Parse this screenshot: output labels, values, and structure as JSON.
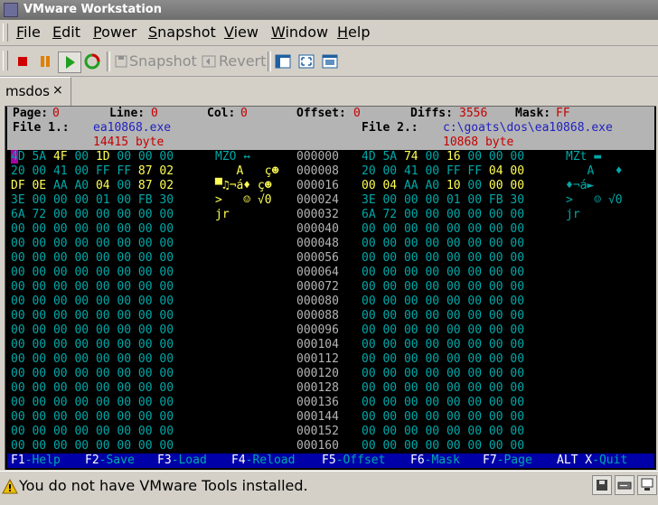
{
  "window": {
    "title": "VMware Workstation"
  },
  "menu": [
    "File",
    "Edit",
    "Power",
    "Snapshot",
    "View",
    "Window",
    "Help"
  ],
  "menu_mnemonics": [
    "F",
    "E",
    "P",
    "S",
    "V",
    "W",
    "H"
  ],
  "toolbar": {
    "snapshot_label": "Snapshot",
    "revert_label": "Revert"
  },
  "tab": {
    "label": "msdos",
    "close": "×"
  },
  "header": {
    "page_label": "Page:",
    "page_value": "0",
    "line_label": "Line:",
    "line_value": "0",
    "col_label": "Col:",
    "col_value": "0",
    "offset_label": "Offset:",
    "offset_value": "0",
    "diffs_label": "Diffs:",
    "diffs_value": "3556",
    "mask_label": "Mask:",
    "mask_value": "FF",
    "file1_label": "File 1.:",
    "file1_name": "ea10868.exe",
    "file1_size": "14415 byte",
    "file2_label": "File 2.:",
    "file2_name": "c:\\goats\\dos\\ea10868.exe",
    "file2_size": "10868 byte"
  },
  "offsets": [
    "000000",
    "000008",
    "000016",
    "000024",
    "000032",
    "000040",
    "000048",
    "000056",
    "000064",
    "000072",
    "000080",
    "000088",
    "000096",
    "000104",
    "000112",
    "000120",
    "000128",
    "000136",
    "000144",
    "000152",
    "000160"
  ],
  "left_rows": [
    "4D 5A 4F 00 1D 00 00 00",
    "20 00 41 00 FF FF 87 02",
    "DF 0E AA A0 04 00 87 02",
    "3E 00 00 00 01 00 FB 30",
    "6A 72 00 00 00 00 00 00",
    "00 00 00 00 00 00 00 00",
    "00 00 00 00 00 00 00 00",
    "00 00 00 00 00 00 00 00",
    "00 00 00 00 00 00 00 00",
    "00 00 00 00 00 00 00 00",
    "00 00 00 00 00 00 00 00",
    "00 00 00 00 00 00 00 00",
    "00 00 00 00 00 00 00 00",
    "00 00 00 00 00 00 00 00",
    "00 00 00 00 00 00 00 00",
    "00 00 00 00 00 00 00 00",
    "00 00 00 00 00 00 00 00",
    "00 00 00 00 00 00 00 00",
    "00 00 00 00 00 00 00 00",
    "00 00 00 00 00 00 00 00",
    "00 00 00 00 00 00 00 00"
  ],
  "right_rows": [
    "4D 5A 74 00 16 00 00 00",
    "20 00 41 00 FF FF 04 00",
    "00 04 AA A0 10 00 00 00",
    "3E 00 00 00 01 00 FB 30",
    "6A 72 00 00 00 00 00 00",
    "00 00 00 00 00 00 00 00",
    "00 00 00 00 00 00 00 00",
    "00 00 00 00 00 00 00 00",
    "00 00 00 00 00 00 00 00",
    "00 00 00 00 00 00 00 00",
    "00 00 00 00 00 00 00 00",
    "00 00 00 00 00 00 00 00",
    "00 00 00 00 00 00 00 00",
    "00 00 00 00 00 00 00 00",
    "00 00 00 00 00 00 00 00",
    "00 00 00 00 00 00 00 00",
    "00 00 00 00 00 00 00 00",
    "00 00 00 00 00 00 00 00",
    "00 00 00 00 00 00 00 00",
    "00 00 00 00 00 00 00 00",
    "00 00 00 00 00 00 00 00"
  ],
  "left_ascii": [
    "MZO ↔",
    "   A   ç☻",
    "▀♫¬á♦ ç☻",
    ">   ☺ √0",
    "jr"
  ],
  "right_ascii": [
    "MZt ▬",
    "   A   ♦",
    "♦¬á►",
    ">   ☺ √0",
    "jr"
  ],
  "fkeys": [
    {
      "key": "F1",
      "label": "-Help"
    },
    {
      "key": "F2",
      "label": "-Save"
    },
    {
      "key": "F3",
      "label": "-Load"
    },
    {
      "key": "F4",
      "label": "-Reload"
    },
    {
      "key": "F5",
      "label": "-Offset"
    },
    {
      "key": "F6",
      "label": "-Mask"
    },
    {
      "key": "F7",
      "label": "-Page"
    },
    {
      "key": "ALT X",
      "label": "-Quit"
    }
  ],
  "status": {
    "message": "You do not have VMware Tools installed."
  },
  "colors": {
    "cyan": "#00a8a8",
    "yellow": "#ffff55",
    "header_bg": "#b4b4b4",
    "fkey_bg": "#0000a8"
  }
}
